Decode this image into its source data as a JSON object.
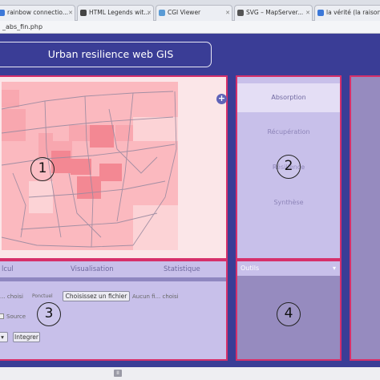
{
  "browser": {
    "tabs": [
      {
        "title": "rainbow connectio...",
        "icon_color": "#3c78d8"
      },
      {
        "title": "HTML Legends wit...",
        "icon_color": "#444444"
      },
      {
        "title": "CGI Viewer",
        "icon_color": "#5a9bd5"
      },
      {
        "title": "SVG – MapServer...",
        "icon_color": "#555555"
      },
      {
        "title": "la vérité (la raison e...",
        "icon_color": "#3c78d8"
      }
    ],
    "address": "_abs_fin.php"
  },
  "header": {
    "title": "Urban resilience web GIS"
  },
  "map": {
    "zoom_button": "+",
    "section_number": "1"
  },
  "menu": {
    "items": [
      "Absorption",
      "Récupération",
      "Résilience",
      "Synthèse"
    ],
    "active_index": 0,
    "section_number": "2"
  },
  "tools": {
    "tabs": [
      "lcul",
      "Visualisation",
      "Statistique"
    ],
    "row1": {
      "label_a": "... choisi",
      "label_b": "Ponctuel",
      "file_button": "Choisissez un fichier",
      "file_status": "Aucun fi... choisi"
    },
    "row2": {
      "label": "Source"
    },
    "row3": {
      "dropdown": "▾",
      "integrate_button": "Integrer"
    },
    "section_number": "3"
  },
  "outils": {
    "title": "Outils",
    "caret": "▾",
    "section_number": "4"
  },
  "statusbar": {
    "button": "II"
  },
  "colors": {
    "background": "#3a3d96",
    "accent": "#d6306a",
    "panel_light": "#c8c0ea",
    "panel_dark": "#968bbf",
    "map_bg": "#fbe6e8"
  }
}
